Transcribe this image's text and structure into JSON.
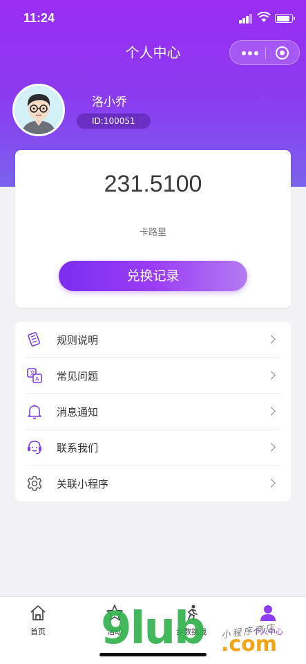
{
  "status_bar": {
    "time": "11:24"
  },
  "nav": {
    "title": "个人中心"
  },
  "profile": {
    "name": "洛小乔",
    "id_label": "ID:100051"
  },
  "balance": {
    "amount": "231.5100",
    "unit": "卡路里",
    "button_label": "兑换记录"
  },
  "menu": {
    "items": [
      {
        "label": "规则说明",
        "icon": "rules-icon"
      },
      {
        "label": "常见问题",
        "icon": "faq-icon"
      },
      {
        "label": "消息通知",
        "icon": "bell-icon"
      },
      {
        "label": "联系我们",
        "icon": "headset-icon"
      },
      {
        "label": "关联小程序",
        "icon": "gear-icon"
      }
    ]
  },
  "tabbar": {
    "tabs": [
      {
        "label": "首页",
        "icon": "home-icon"
      },
      {
        "label": "活动",
        "icon": "star-icon"
      },
      {
        "label": "步数挑战",
        "icon": "runner-icon"
      },
      {
        "label": "个人中心",
        "icon": "user-icon"
      }
    ],
    "active_index": 3
  },
  "watermark": {
    "brand": "9lub",
    "domain": ".com",
    "text": "小程序商店"
  },
  "colors": {
    "accent": "#8e3df1",
    "hero_top": "#9a2cf2",
    "hero_bottom": "#7a63ec"
  }
}
